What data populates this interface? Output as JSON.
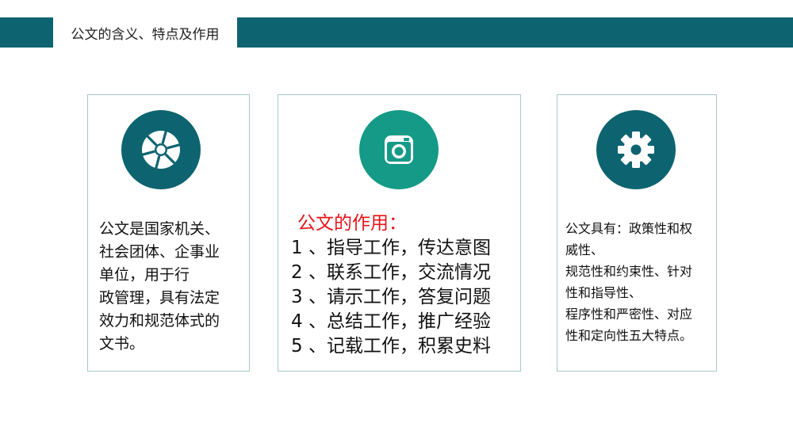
{
  "header": {
    "title": "公文的含义、特点及作用"
  },
  "colors": {
    "primary": "#0d6470",
    "accent": "#149a86",
    "highlight": "#e8141b"
  },
  "cards": [
    {
      "icon": "aperture-icon",
      "lines": [
        "公文是国家机关、",
        "社会团体、企事业",
        "单位，用于行",
        "政管理，具有法定",
        "效力和规范体式的",
        "文书。"
      ]
    },
    {
      "icon": "camera-icon",
      "title": "公文的作用：",
      "items": [
        "1 、指导工作，传达意图",
        "2 、联系工作，交流情况",
        "3 、请示工作，答复问题",
        "4 、总结工作，推广经验",
        "5 、记载工作，积累史料"
      ]
    },
    {
      "icon": "gear-icon",
      "lines": [
        "公文具有：政策性和权",
        "威性、",
        "规范性和约束性、针对",
        "性和指导性、",
        "程序性和严密性、对应",
        "性和定向性五大特点。"
      ]
    }
  ]
}
